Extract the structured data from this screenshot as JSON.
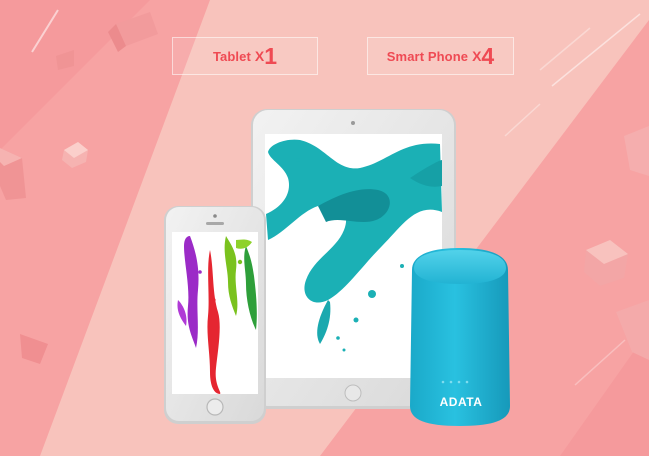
{
  "badges": [
    {
      "device": "Tablet",
      "x": "X",
      "count": "1"
    },
    {
      "device": "Smart Phone",
      "x": "X",
      "count": "4"
    }
  ],
  "product": {
    "brand": "ADATA"
  },
  "colors": {
    "badge_text": "#ef4a53",
    "background": "#f7a2a3",
    "light_band": "#f8c2bc",
    "power_bank": "#1fb6d6",
    "tablet_splash": "#1aaeb3"
  },
  "icons": [
    "tablet-device",
    "smartphone-device",
    "power-bank",
    "paint-splash",
    "floating-cube"
  ]
}
